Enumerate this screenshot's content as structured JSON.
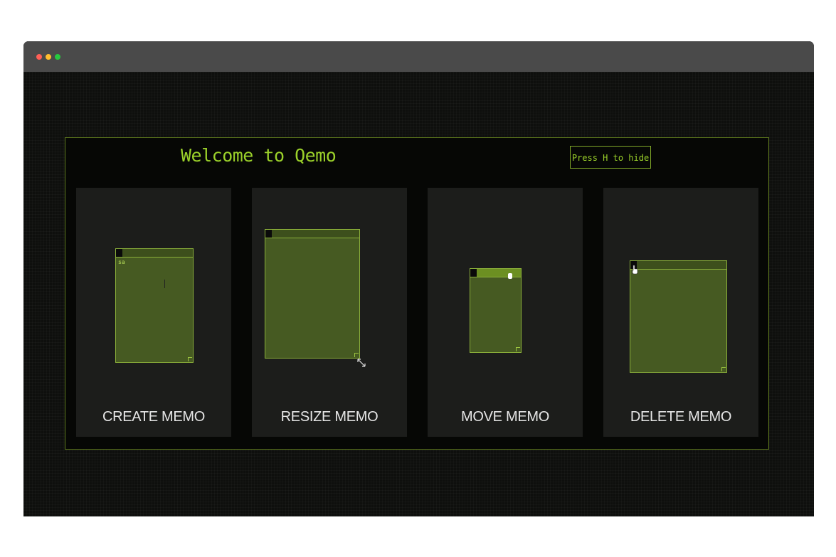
{
  "window": {
    "controls": [
      "close",
      "minimize",
      "maximize"
    ]
  },
  "app": {
    "welcome": "Welcome to Qemo",
    "hide_hint": "Press H to hide"
  },
  "cards": [
    {
      "label": "CREATE MEMO",
      "memo_text": "sa",
      "icon": "memo-create-demo"
    },
    {
      "label": "RESIZE MEMO",
      "icon": "memo-resize-demo"
    },
    {
      "label": "MOVE MEMO",
      "icon": "memo-move-demo"
    },
    {
      "label": "DELETE MEMO",
      "icon": "memo-delete-demo"
    }
  ],
  "colors": {
    "accent": "#9bd12a",
    "memo_fill": "#465a22",
    "memo_border": "#8bb03a",
    "panel_border": "#5f7a1e",
    "card_bg": "#1c1d1b"
  }
}
